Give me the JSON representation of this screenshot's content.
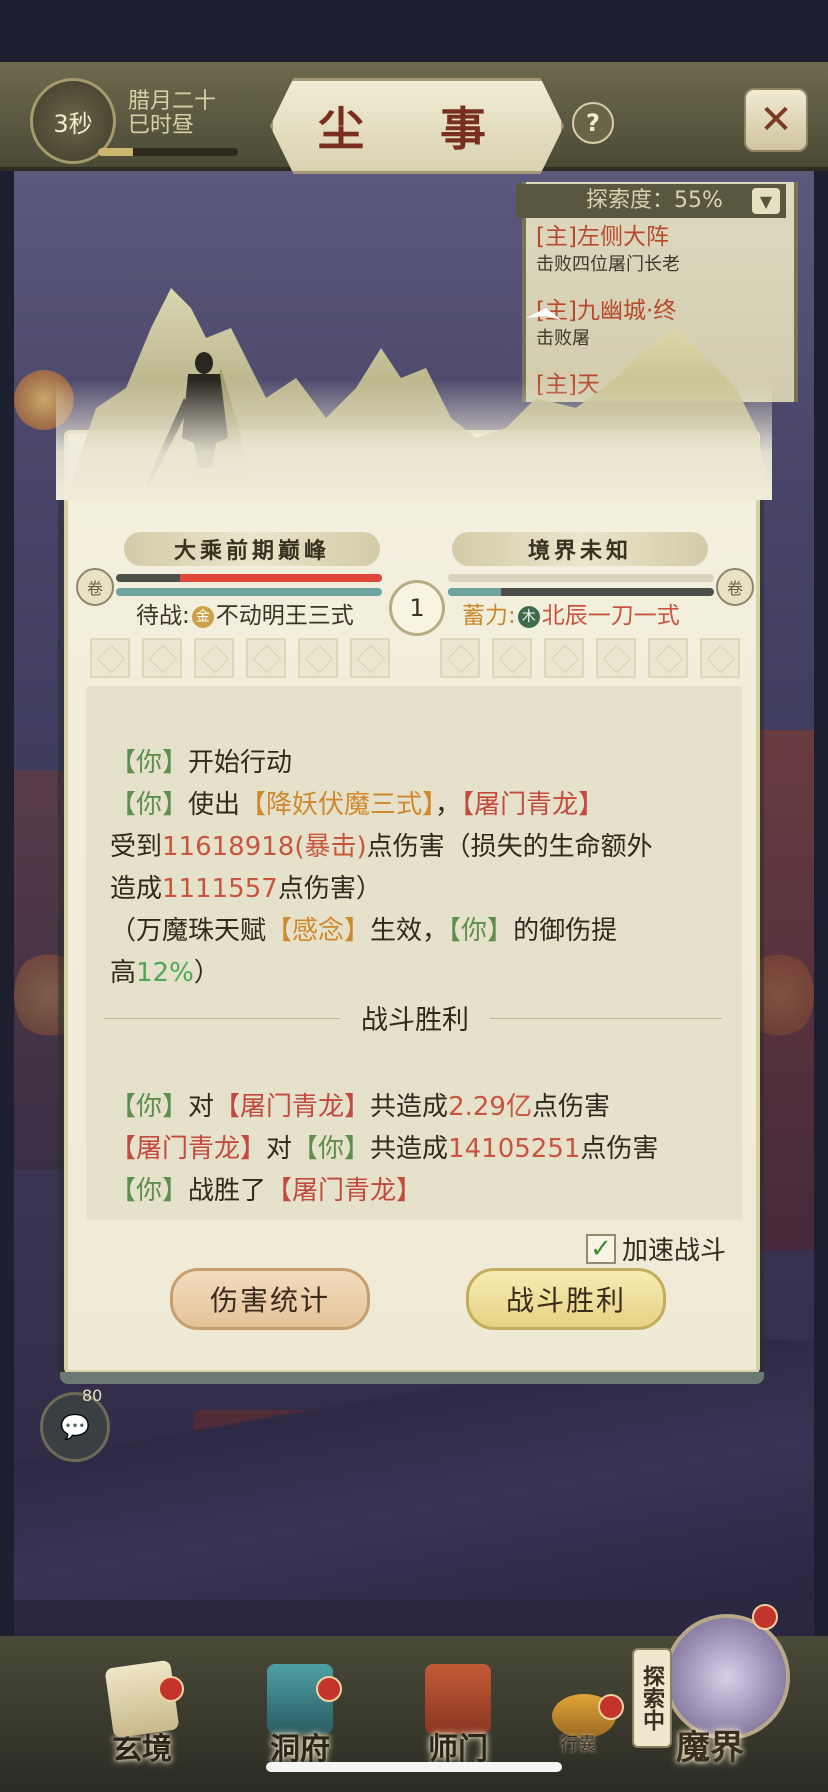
{
  "header": {
    "timer": "3秒",
    "date_line1": "腊月二十",
    "date_line2": "巳时昼",
    "title": "尘 事",
    "help_label": "?",
    "close_label": "✕"
  },
  "quest_panel": {
    "exploration": "探索度：55%",
    "items": [
      {
        "title": "[主]左侧大阵",
        "desc": "击败四位屠门长老"
      },
      {
        "title": "[主]九幽城·终",
        "desc": "击败屠"
      },
      {
        "title": "[主]天",
        "desc": ""
      }
    ]
  },
  "battle": {
    "player_rank": "大乘前期巅峰",
    "enemy_rank": "境界未知",
    "player_hp": 0.76,
    "player_mp": 1.0,
    "enemy_hp": 1.0,
    "enemy_mp": 0.2,
    "round": "1",
    "player_stance_label": "待战:",
    "player_stance_elem": "金",
    "player_stance_skill": "不动明王三式",
    "enemy_stance_label": "蓄力:",
    "enemy_stance_elem": "木",
    "enemy_stance_skill": "北辰一刀一式",
    "colors": {
      "hp": "#e0463a",
      "mp": "#6fa3a0"
    }
  },
  "log": {
    "l1_who": "【你】",
    "l1_text": "开始行动",
    "l2_who": "【你】",
    "l2_a": "使出",
    "l2_skill": "【降妖伏魔三式】",
    "l2_b": "，",
    "l2_target": "【屠门青龙】",
    "l3_a": "受到",
    "l3_dmg": "11618918(暴击)",
    "l3_b": "点伤害（损失的生命额外",
    "l4_a": "造成",
    "l4_dmg": "1111557",
    "l4_b": "点伤害）",
    "l5_a": "（万魔珠天赋",
    "l5_talent": "【感念】",
    "l5_b": "生效，",
    "l5_who": "【你】",
    "l5_c": "的御伤提",
    "l6_a": "高",
    "l6_pct": "12%",
    "l6_b": "）",
    "divider": "战斗胜利",
    "s1_who": "【你】",
    "s1_a": "对",
    "s1_target": "【屠门青龙】",
    "s1_b": "共造成",
    "s1_dmg": "2.29亿",
    "s1_c": "点伤害",
    "s2_who": "【屠门青龙】",
    "s2_a": "对",
    "s2_target": "【你】",
    "s2_b": "共造成",
    "s2_dmg": "14105251",
    "s2_c": "点伤害",
    "s3_who": "【你】",
    "s3_a": "战胜了",
    "s3_target": "【屠门青龙】"
  },
  "controls": {
    "speed_label": "加速战斗",
    "speed_checked": true,
    "stats_button": "伤害统计",
    "win_button": "战斗胜利"
  },
  "chat": {
    "count": "80"
  },
  "bottom_nav": {
    "items": [
      "玄境",
      "洞府",
      "师门"
    ],
    "bag_label": "行囊",
    "explore_tag": "探索中",
    "demon_label": "魔界"
  }
}
